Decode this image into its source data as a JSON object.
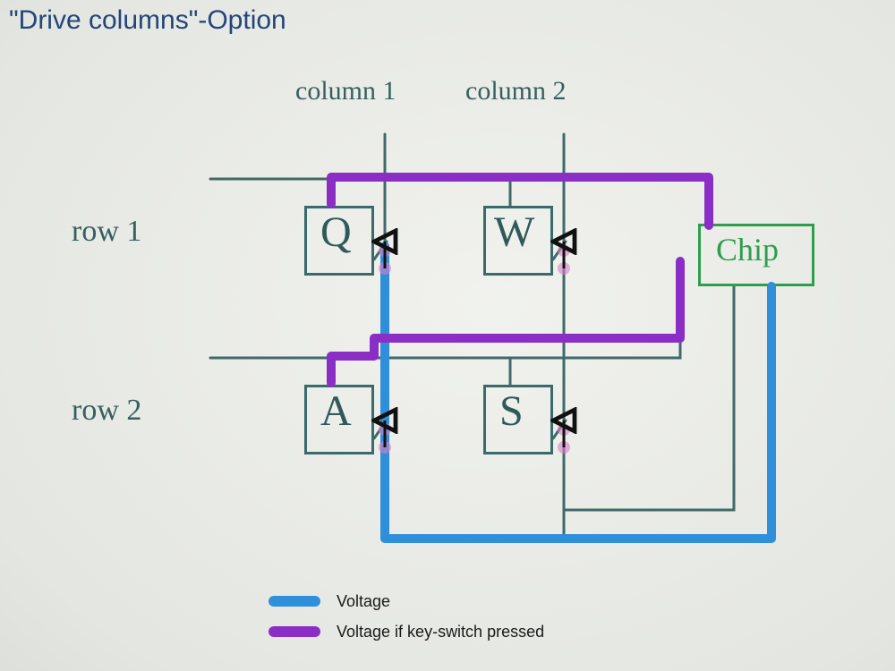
{
  "title": "\"Drive columns\"-Option",
  "columns": {
    "c1": "column 1",
    "c2": "column 2"
  },
  "rows": {
    "r1": "row 1",
    "r2": "row 2"
  },
  "keys": {
    "q": "Q",
    "w": "W",
    "a": "A",
    "s": "S"
  },
  "chip": "Chip",
  "legend": {
    "voltage": "Voltage",
    "voltage_if_pressed": "Voltage if key-switch pressed"
  },
  "colors": {
    "ink": "#35605f",
    "chip": "#2e9e4d",
    "voltage": "#2f8fda",
    "voltage_pressed": "#8a2ec6",
    "title": "#23457a"
  }
}
